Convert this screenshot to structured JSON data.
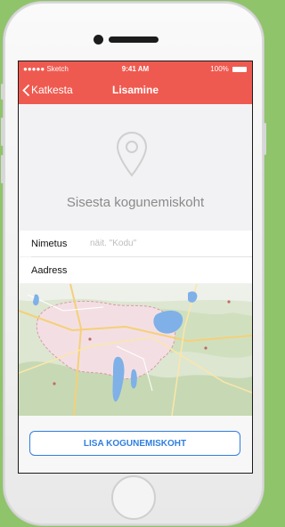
{
  "status_bar": {
    "carrier": "●●●●● Sketch",
    "time": "9:41 AM",
    "battery": "100%"
  },
  "nav": {
    "back_label": "Katkesta",
    "title": "Lisamine"
  },
  "main": {
    "headline": "Sisesta kogunemiskoht"
  },
  "form": {
    "name_label": "Nimetus",
    "name_placeholder": "näit. \"Kodu\"",
    "name_value": "",
    "address_label": "Aadress",
    "address_value": ""
  },
  "actions": {
    "add_label": "LISA KOGUNEMISKOHT"
  },
  "colors": {
    "accent": "#ef5a50",
    "button": "#2f7fe0",
    "background": "#8fc46a"
  }
}
